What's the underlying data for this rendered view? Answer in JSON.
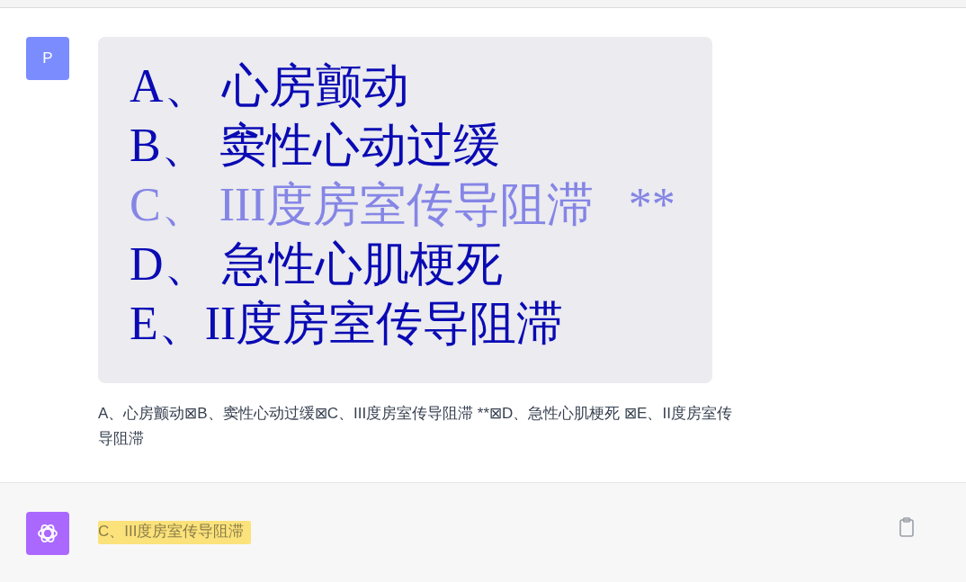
{
  "user": {
    "avatar": "P",
    "image_lines": [
      {
        "text": "A、 心房颤动",
        "highlighted": false
      },
      {
        "text": "B、 窦性心动过缓",
        "highlighted": false
      },
      {
        "text": "C、 III度房室传导阻滞   **",
        "highlighted": true
      },
      {
        "text": "D、 急性心肌梗死",
        "highlighted": false
      },
      {
        "text": "E、II度房室传导阻滞",
        "highlighted": false
      }
    ],
    "text": "A、心房颤动⊠B、窦性心动过缓⊠C、III度房室传导阻滞 **⊠D、急性心肌梗死 ⊠E、II度房室传导阻滞"
  },
  "assistant": {
    "answer": "C、III度房室传导阻滞"
  }
}
